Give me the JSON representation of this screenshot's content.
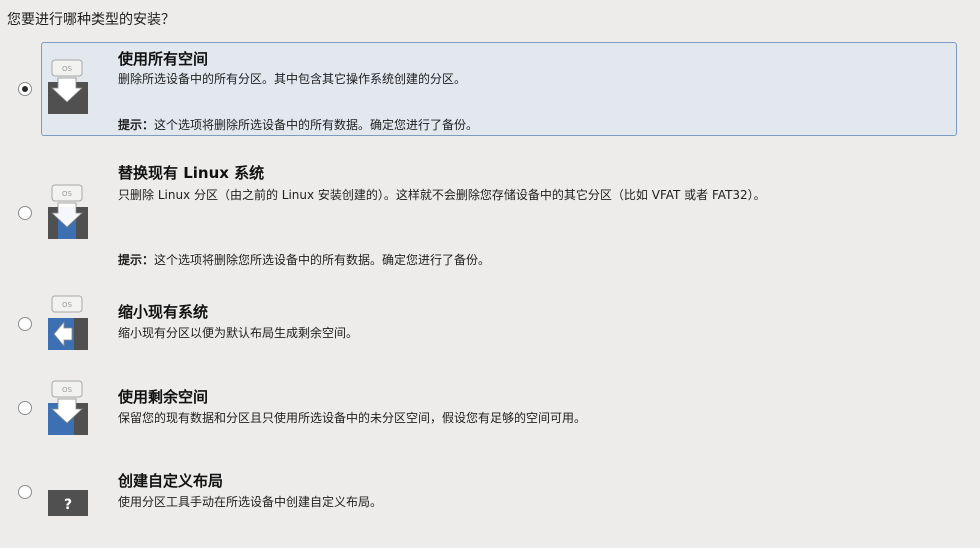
{
  "question": "您要进行哪种类型的安装？",
  "options": [
    {
      "title": "使用所有空间",
      "description": "删除所选设备中的所有分区。其中包含其它操作系统创建的分区。",
      "tip_label": "提示：",
      "tip_text": "这个选项将删除所选设备中的所有数据。确定您进行了备份。",
      "selected": true,
      "icon": "disk-erase-all-icon",
      "icon_label": "OS"
    },
    {
      "title": "替换现有 Linux 系统",
      "description": "只删除 Linux 分区（由之前的 Linux 安装创建的）。这样就不会删除您存储设备中的其它分区（比如 VFAT 或者 FAT32）。",
      "tip_label": "提示：",
      "tip_text": "这个选项将删除您所选设备中的所有数据。确定您进行了备份。",
      "selected": false,
      "icon": "disk-replace-linux-icon",
      "icon_label": "OS"
    },
    {
      "title": "缩小现有系统",
      "description": "缩小现有分区以便为默认布局生成剩余空间。",
      "selected": false,
      "icon": "disk-shrink-icon",
      "icon_label": "OS"
    },
    {
      "title": "使用剩余空间",
      "description": "保留您的现有数据和分区且只使用所选设备中的未分区空间，假设您有足够的空间可用。",
      "selected": false,
      "icon": "disk-free-space-icon",
      "icon_label": "OS"
    },
    {
      "title": "创建自定义布局",
      "description": "使用分区工具手动在所选设备中创建自定义布局。",
      "selected": false,
      "icon": "custom-layout-question-icon",
      "icon_label": "?"
    }
  ],
  "colors": {
    "background": "#edeceb",
    "selected_bg": "#e3e8ef",
    "selected_border": "#7c9cc2",
    "disk_blue": "#3d6fb3",
    "disk_dark": "#4a4a4a"
  }
}
